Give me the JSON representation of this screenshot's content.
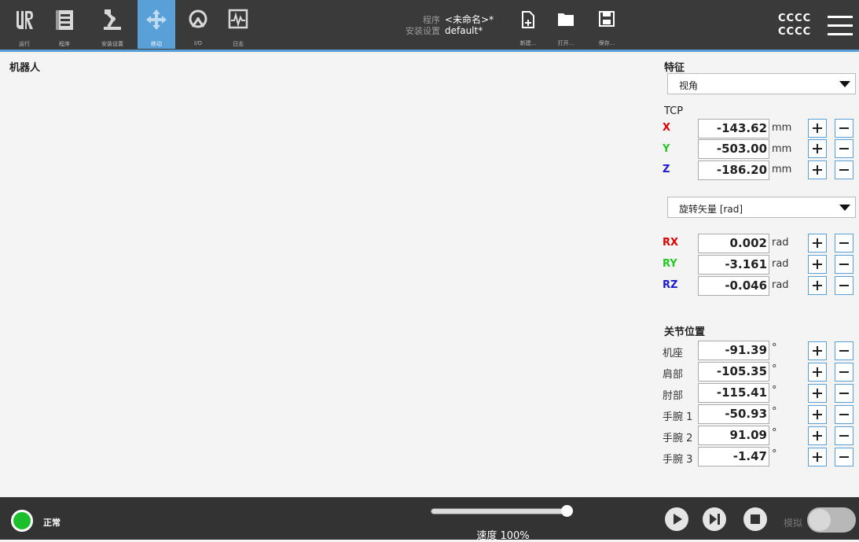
{
  "header": {
    "tabs": [
      {
        "label": "运行",
        "icon": "ur-logo-icon"
      },
      {
        "label": "程序",
        "icon": "program-icon"
      },
      {
        "label": "安装设置",
        "icon": "robot-arm-icon"
      },
      {
        "label": "移动",
        "icon": "move-arrows-icon"
      },
      {
        "label": "I/O",
        "icon": "io-gauge-icon"
      },
      {
        "label": "日志",
        "icon": "log-waveform-icon"
      }
    ],
    "program_key": "程序",
    "program_value": "<未命名>*",
    "installation_key": "安装设置",
    "installation_value": "default*",
    "file_buttons": [
      {
        "label": "新建...",
        "icon": "new-file-icon"
      },
      {
        "label": "打开...",
        "icon": "folder-icon"
      },
      {
        "label": "保存...",
        "icon": "save-icon"
      }
    ],
    "user_line1": "CCCC",
    "user_line2": "CCCC"
  },
  "main": {
    "title": "机器人"
  },
  "feature": {
    "heading": "特征",
    "selected": "视角"
  },
  "tcp": {
    "heading": "TCP",
    "rows": [
      {
        "label": "X",
        "value": "-143.62",
        "unit": "mm",
        "color": "#e00000"
      },
      {
        "label": "Y",
        "value": "-503.00",
        "unit": "mm",
        "color": "#22c922"
      },
      {
        "label": "Z",
        "value": "-186.20",
        "unit": "mm",
        "color": "#1a1ad0"
      }
    ],
    "rotation_selected": "旋转矢量 [rad]",
    "rot_rows": [
      {
        "label": "RX",
        "value": "0.002",
        "unit": "rad",
        "color": "#e00000"
      },
      {
        "label": "RY",
        "value": "-3.161",
        "unit": "rad",
        "color": "#22c922"
      },
      {
        "label": "RZ",
        "value": "-0.046",
        "unit": "rad",
        "color": "#1a1ad0"
      }
    ]
  },
  "joints": {
    "heading": "关节位置",
    "rows": [
      {
        "label": "机座",
        "value": "-91.39",
        "unit": "°"
      },
      {
        "label": "肩部",
        "value": "-105.35",
        "unit": "°"
      },
      {
        "label": "肘部",
        "value": "-115.41",
        "unit": "°"
      },
      {
        "label": "手腕 1",
        "value": "-50.93",
        "unit": "°"
      },
      {
        "label": "手腕 2",
        "value": "91.09",
        "unit": "°"
      },
      {
        "label": "手腕 3",
        "value": "-1.47",
        "unit": "°"
      }
    ]
  },
  "footer": {
    "status": "正常",
    "status_color": "#1bbf2b",
    "speed_label": "速度 100%",
    "speed_fraction": 1.0,
    "simulation_label": "模拟",
    "simulation_on": false
  },
  "accent": "#5aa0d8"
}
